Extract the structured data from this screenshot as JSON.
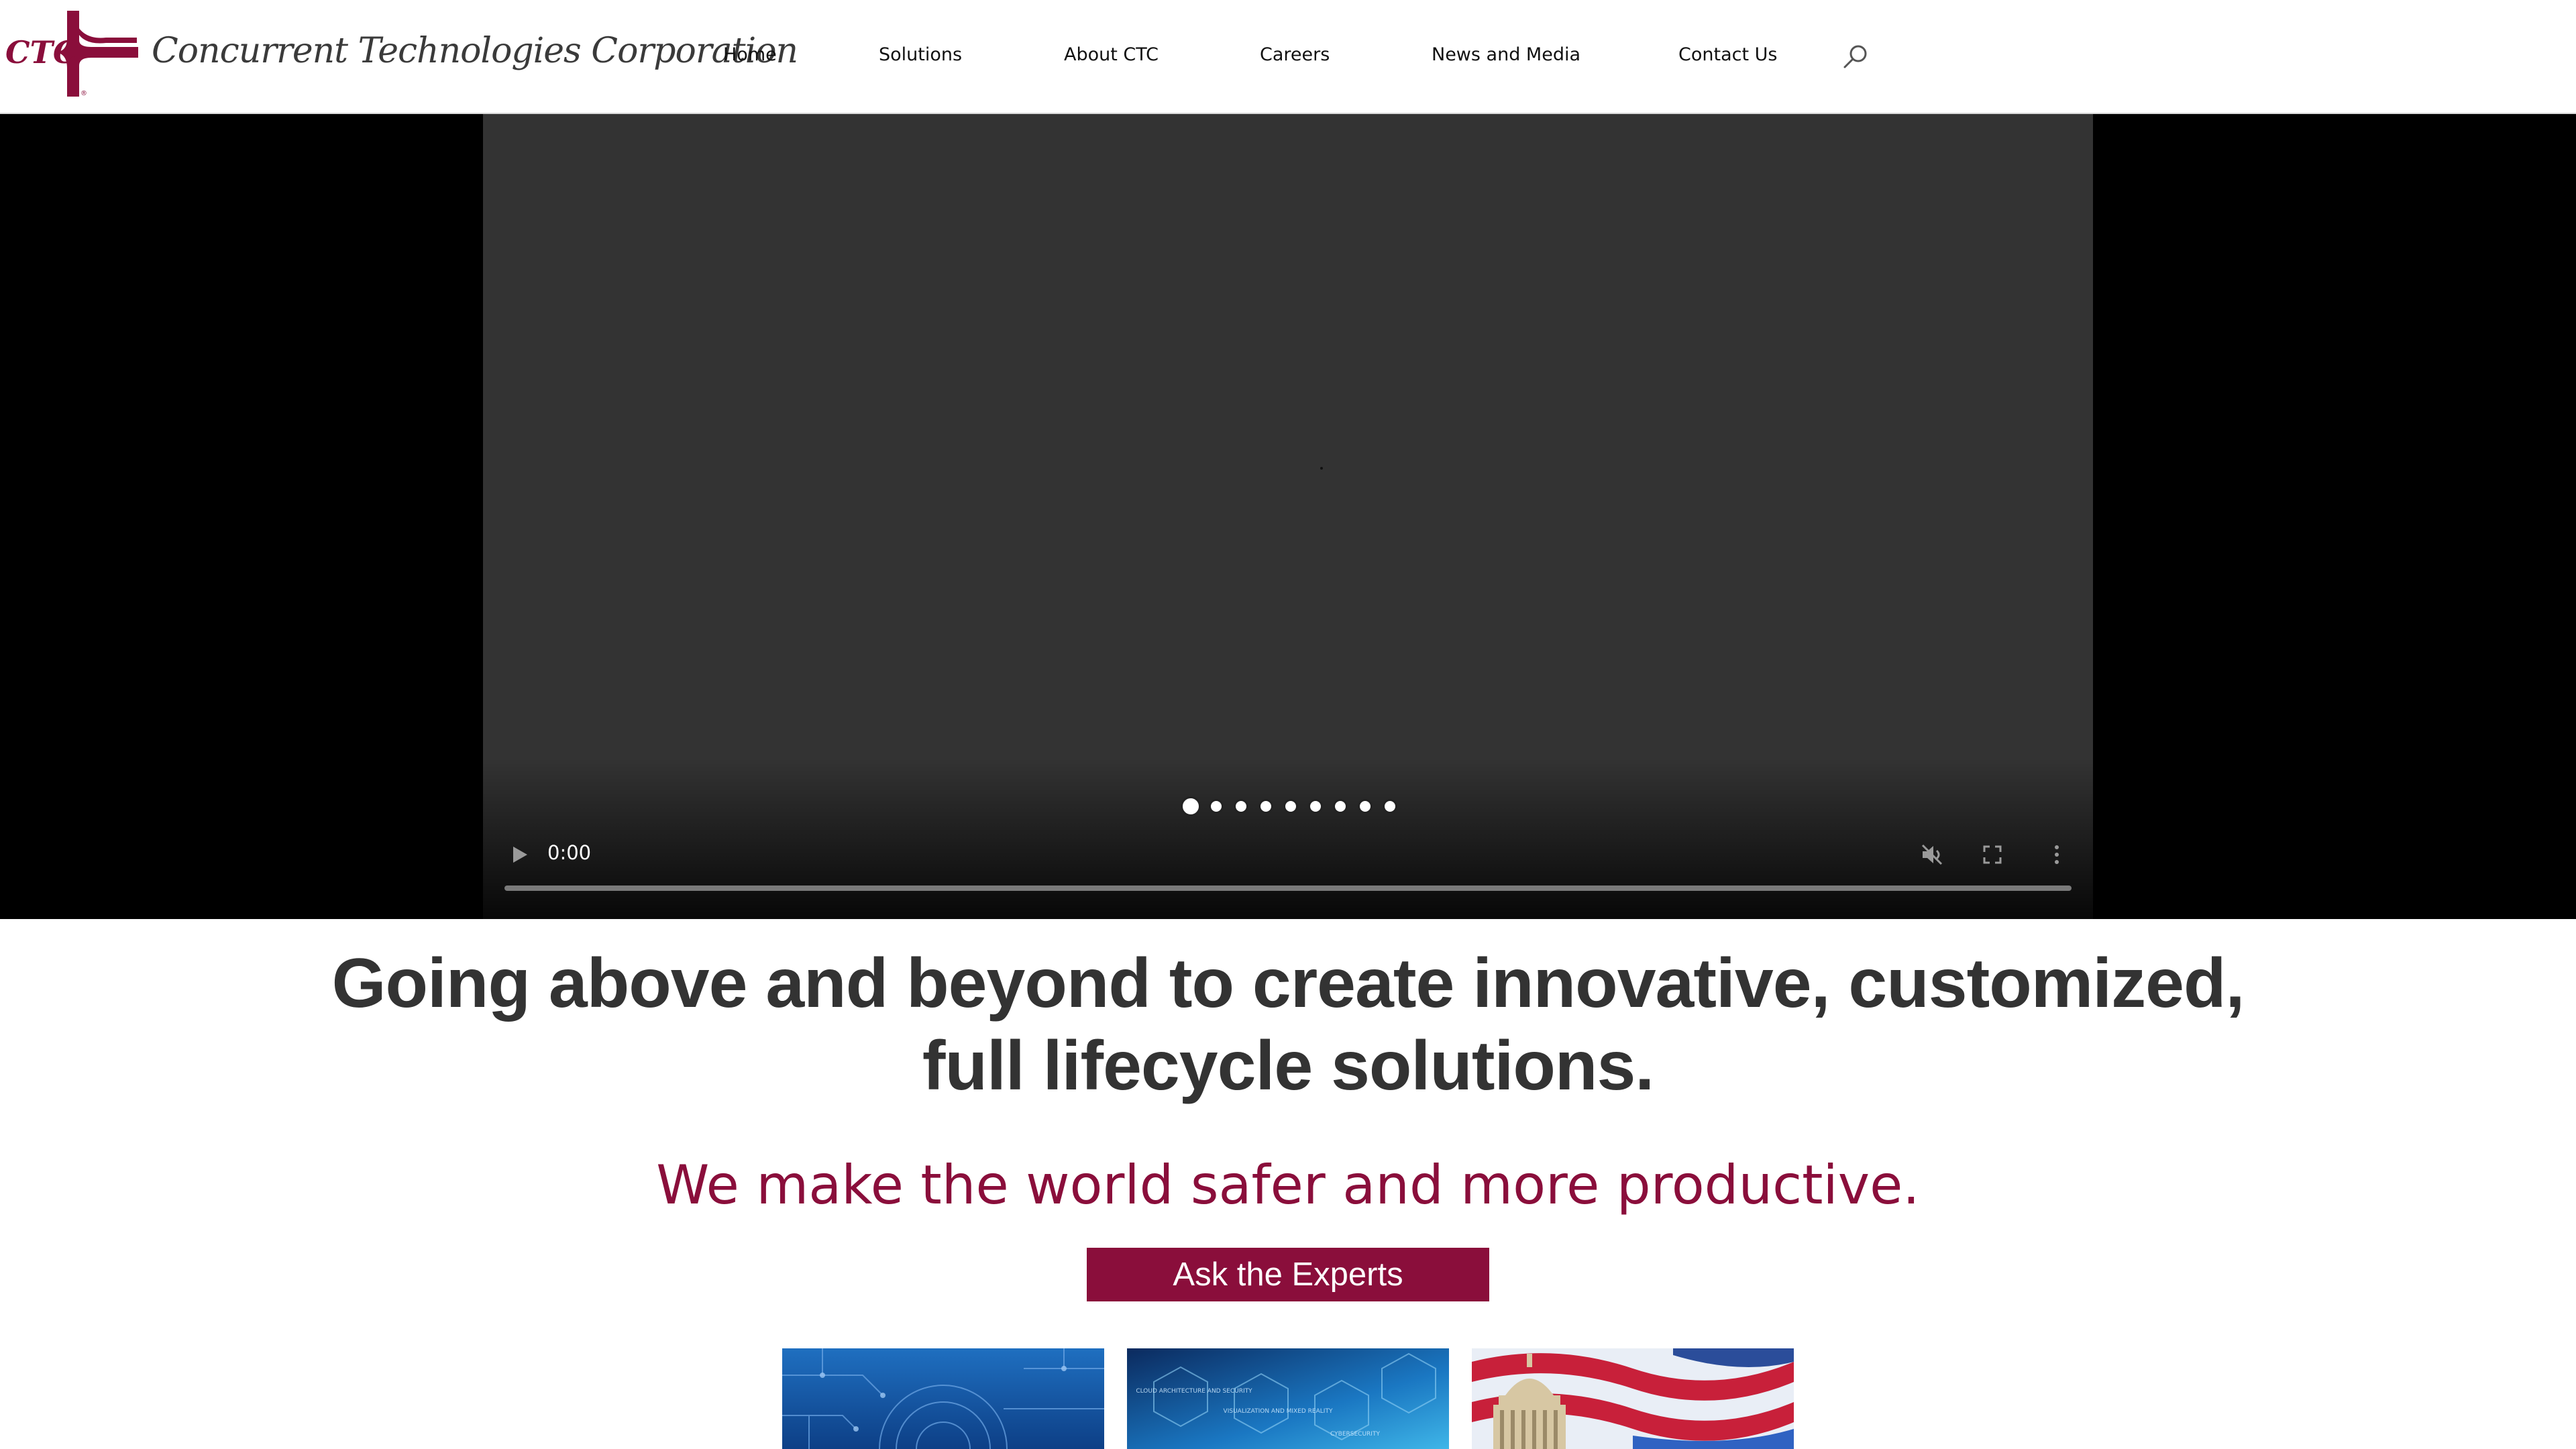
{
  "header": {
    "logo_text": "CTC",
    "company_name": "Concurrent Technologies Corporation",
    "nav": [
      {
        "label": "Home"
      },
      {
        "label": "Solutions"
      },
      {
        "label": "About CTC"
      },
      {
        "label": "Careers"
      },
      {
        "label": "News and Media"
      },
      {
        "label": "Contact Us"
      }
    ],
    "search_icon": "search-icon"
  },
  "hero_video": {
    "current_time": "0:00",
    "progress": 0,
    "muted": true,
    "slides_total": 9,
    "active_slide": 1,
    "controls": [
      "play-icon",
      "mute-icon",
      "fullscreen-icon",
      "more-options-icon"
    ]
  },
  "main": {
    "headline": "Going above and beyond to create innovative, customized, full lifecycle solutions.",
    "tagline": "We make the world safer and more productive.",
    "cta_label": "Ask the Experts"
  },
  "tiles": [
    {
      "image": "blue-circuit-gear"
    },
    {
      "image": "blue-hexagon-technology",
      "labels": [
        "CLOUD ARCHITECTURE AND SECURITY",
        "VISUALIZATION AND MIXED REALITY",
        "CYBERSECURITY"
      ]
    },
    {
      "image": "capitol-dome-flag"
    }
  ],
  "colors": {
    "brand_red": "#8a0e3b",
    "headline_gray": "#333333",
    "video_bg": "#333333",
    "page_bg": "#ffffff"
  }
}
